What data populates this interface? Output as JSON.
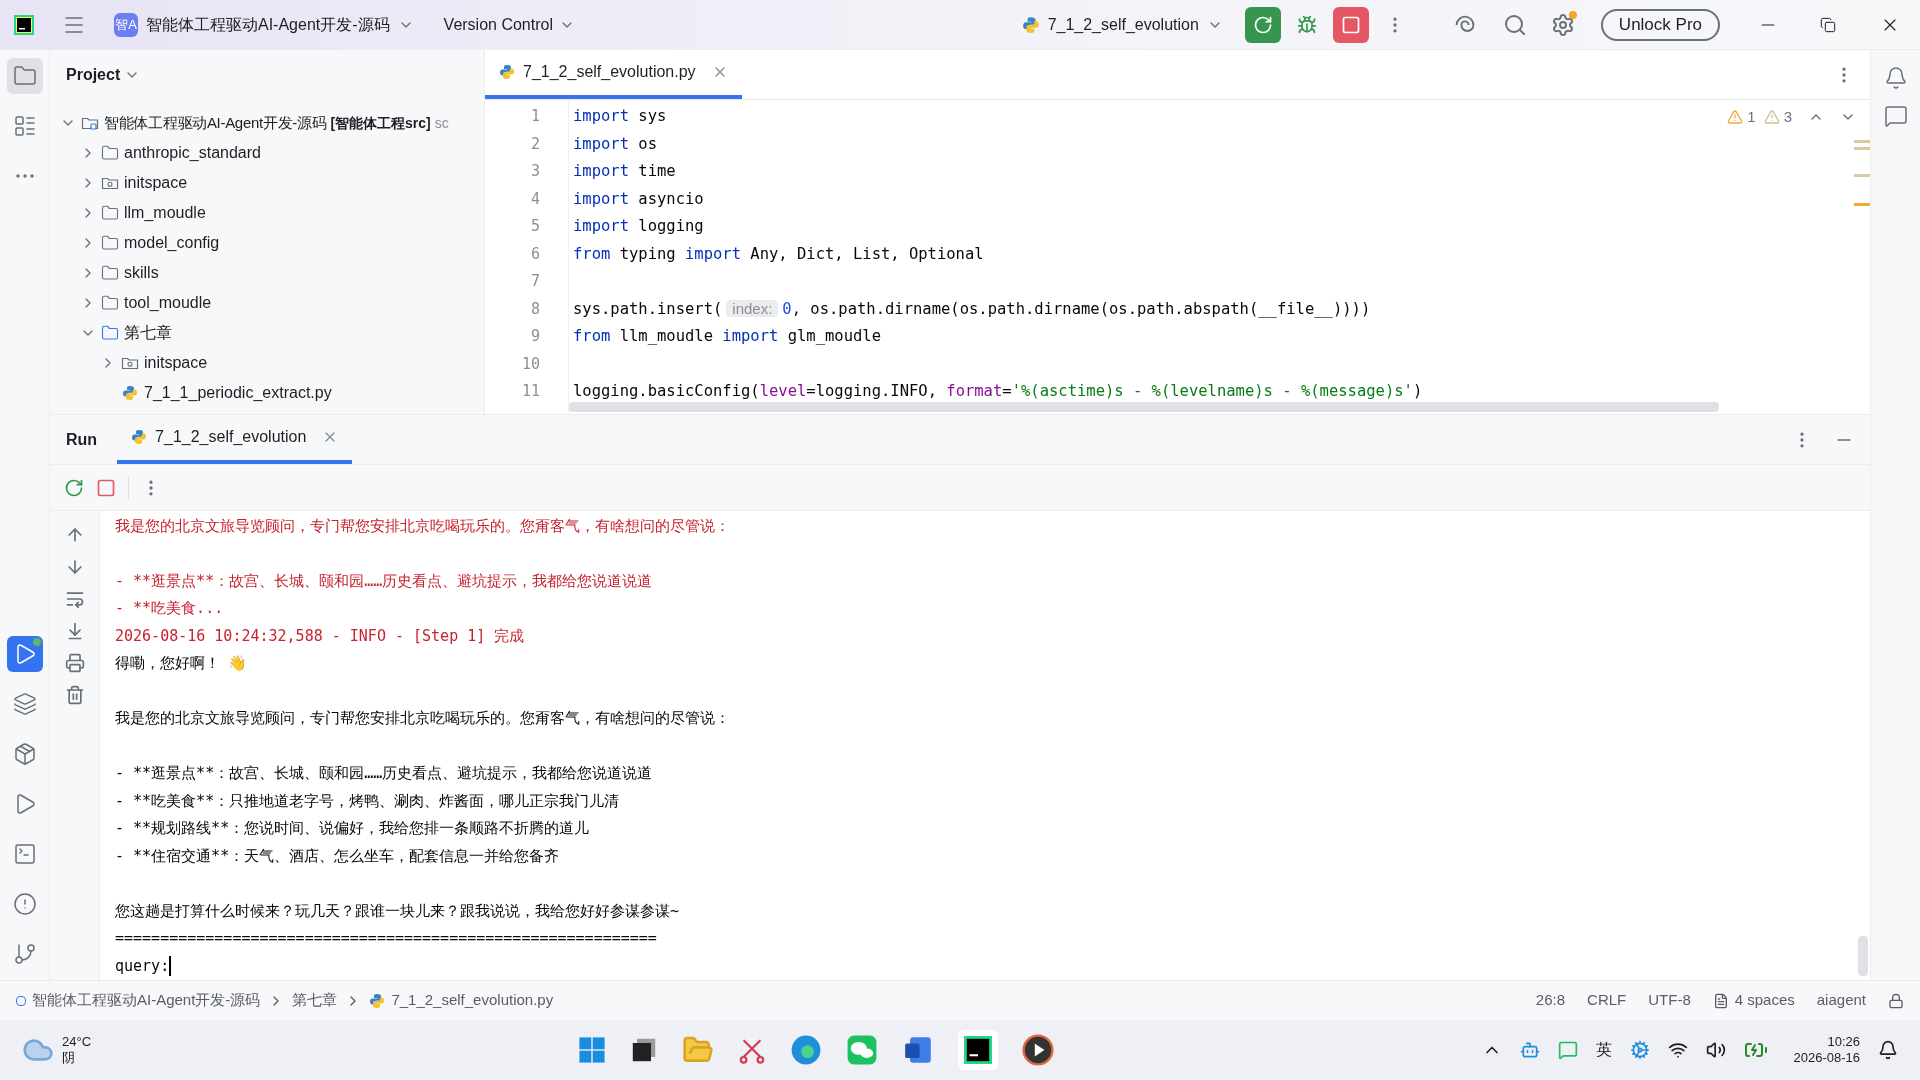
{
  "title_bar": {
    "project_badge": "智A",
    "project": "智能体工程驱动AI-Agent开发-源码",
    "vcs": "Version Control",
    "run_config": "7_1_2_self_evolution",
    "unlock": "Unlock Pro"
  },
  "project_panel": {
    "title": "Project",
    "tree": [
      {
        "kind": "root",
        "label": "智能体工程驱动AI-Agent开发-源码",
        "tag": "[智能体工程src]",
        "hint": "sc",
        "expanded": true,
        "children": [
          {
            "kind": "folder",
            "label": "anthropic_standard",
            "expanded": false
          },
          {
            "kind": "module",
            "label": "initspace",
            "expanded": false
          },
          {
            "kind": "folder",
            "label": "llm_moudle",
            "expanded": false
          },
          {
            "kind": "folder",
            "label": "model_config",
            "expanded": false
          },
          {
            "kind": "folder",
            "label": "skills",
            "expanded": false
          },
          {
            "kind": "folder",
            "label": "tool_moudle",
            "expanded": false
          },
          {
            "kind": "folder",
            "label": "第七章",
            "expanded": true,
            "children": [
              {
                "kind": "module",
                "label": "initspace",
                "expanded": false
              },
              {
                "kind": "python",
                "label": "7_1_1_periodic_extract.py"
              }
            ]
          }
        ]
      }
    ]
  },
  "editor": {
    "tabs": [
      {
        "label": "7_1_2_self_evolution.py",
        "selected": true
      }
    ],
    "warnings": [
      {
        "kind": "warning",
        "count": "1"
      },
      {
        "kind": "weak",
        "count": "3"
      }
    ],
    "lines": [
      {
        "number": "1",
        "tokens": [
          {
            "kind": "keyword",
            "text": "import"
          },
          {
            "kind": "plain",
            "text": " sys"
          }
        ]
      },
      {
        "number": "2",
        "tokens": [
          {
            "kind": "keyword",
            "text": "import"
          },
          {
            "kind": "plain",
            "text": " os"
          }
        ]
      },
      {
        "number": "3",
        "tokens": [
          {
            "kind": "keyword",
            "text": "import"
          },
          {
            "kind": "plain",
            "text": " time"
          }
        ]
      },
      {
        "number": "4",
        "tokens": [
          {
            "kind": "keyword",
            "text": "import"
          },
          {
            "kind": "plain",
            "text": " asyncio"
          }
        ]
      },
      {
        "number": "5",
        "tokens": [
          {
            "kind": "keyword",
            "text": "import"
          },
          {
            "kind": "plain",
            "text": " logging"
          }
        ]
      },
      {
        "number": "6",
        "tokens": [
          {
            "kind": "keyword",
            "text": "from"
          },
          {
            "kind": "plain",
            "text": " typing "
          },
          {
            "kind": "keyword",
            "text": "import"
          },
          {
            "kind": "plain",
            "text": " Any, Dict, List, Optional"
          }
        ]
      },
      {
        "number": "7"
      },
      {
        "number": "8",
        "tokens": [
          {
            "kind": "plain",
            "text": "sys.path.insert("
          },
          {
            "kind": "hint",
            "text": "index:"
          },
          {
            "kind": "number",
            "text": "0"
          },
          {
            "kind": "plain",
            "text": ", os.path.dirname(os.path.dirname(os.path.abspath(__file__))))"
          }
        ]
      },
      {
        "number": "9",
        "tokens": [
          {
            "kind": "keyword",
            "text": "from"
          },
          {
            "kind": "plain",
            "text": " llm_moudle "
          },
          {
            "kind": "keyword",
            "text": "import"
          },
          {
            "kind": "plain",
            "text": " glm_moudle"
          }
        ]
      },
      {
        "number": "10"
      },
      {
        "number": "11",
        "tokens": [
          {
            "kind": "plain",
            "text": "logging.basicConfig("
          },
          {
            "kind": "param",
            "text": "level"
          },
          {
            "kind": "plain",
            "text": "=logging.INFO, "
          },
          {
            "kind": "param",
            "text": "format"
          },
          {
            "kind": "plain",
            "text": "="
          },
          {
            "kind": "string",
            "text": "'%(asctime)s - %(levelname)s - %(message)s'"
          },
          {
            "kind": "plain",
            "text": ")"
          }
        ]
      }
    ]
  },
  "run_panel": {
    "title": "Run",
    "tabs": [
      {
        "label": "7_1_2_self_evolution",
        "selected": true
      }
    ],
    "console": [
      {
        "kind": "error",
        "text": "我是您的北京文旅导览顾问，专门帮您安排北京吃喝玩乐的。您甭客气，有啥想问的尽管说："
      },
      {
        "kind": "blank"
      },
      {
        "kind": "error",
        "text": "- **逛景点**：故宫、长城、颐和园……历史看点、避坑提示，我都给您说道说道"
      },
      {
        "kind": "error",
        "text": "- **吃美食..."
      },
      {
        "kind": "error",
        "text": "2026-08-16 10:24:32,588 - INFO - [Step 1] 完成"
      },
      {
        "kind": "normal",
        "text": "得嘞，您好啊！",
        "emoji": "👋"
      },
      {
        "kind": "blank"
      },
      {
        "kind": "normal",
        "text": "我是您的北京文旅导览顾问，专门帮您安排北京吃喝玩乐的。您甭客气，有啥想问的尽管说："
      },
      {
        "kind": "blank"
      },
      {
        "kind": "normal",
        "text": "- **逛景点**：故宫、长城、颐和园……历史看点、避坑提示，我都给您说道说道"
      },
      {
        "kind": "normal",
        "text": "- **吃美食**：只推地道老字号，烤鸭、涮肉、炸酱面，哪儿正宗我门儿清"
      },
      {
        "kind": "normal",
        "text": "- **规划路线**：您说时间、说偏好，我给您排一条顺路不折腾的道儿"
      },
      {
        "kind": "normal",
        "text": "- **住宿交通**：天气、酒店、怎么坐车，配套信息一并给您备齐"
      },
      {
        "kind": "blank"
      },
      {
        "kind": "normal",
        "text": "您这趟是打算什么时候来？玩几天？跟谁一块儿来？跟我说说，我给您好好参谋参谋~"
      },
      {
        "kind": "normal",
        "text": "============================================================"
      },
      {
        "kind": "input",
        "text": "query:"
      }
    ]
  },
  "status_bar": {
    "breadcrumbs": [
      {
        "kind": "module",
        "label": "智能体工程驱动AI-Agent开发-源码"
      },
      {
        "kind": "folder",
        "label": "第七章"
      },
      {
        "kind": "python",
        "label": "7_1_2_self_evolution.py"
      }
    ],
    "items": [
      {
        "kind": "text",
        "label": "26:8"
      },
      {
        "kind": "text",
        "label": "CRLF"
      },
      {
        "kind": "text",
        "label": "UTF-8"
      },
      {
        "kind": "indent",
        "label": "4 spaces"
      },
      {
        "kind": "text",
        "label": "aiagent"
      }
    ]
  },
  "taskbar": {
    "weather": {
      "temp": "24°C",
      "condition": "阴"
    },
    "input_method": "英",
    "time": "10:26",
    "date": "2026-08-16"
  }
}
